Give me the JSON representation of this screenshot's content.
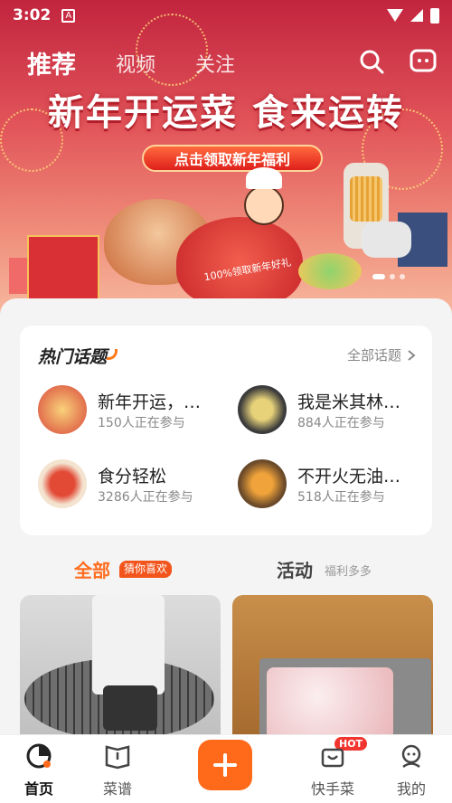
{
  "status_bar": {
    "time": "3:02",
    "notification_icon": "A"
  },
  "top_nav": {
    "tabs": [
      {
        "label": "推荐",
        "active": true
      },
      {
        "label": "视频",
        "active": false
      },
      {
        "label": "关注",
        "active": false
      }
    ],
    "search_icon": "search-icon",
    "message_icon": "message-icon"
  },
  "banner": {
    "headline": "新年开运菜 食来运转",
    "promo_button": "点击领取新年福利",
    "sack_text": "100%领取新年好礼",
    "page_dots": 3,
    "active_dot": 0
  },
  "topics": {
    "title": "热门话题",
    "all_link": "全部话题",
    "items": [
      {
        "name": "新年开运，…",
        "count": "150人正在参与"
      },
      {
        "name": "我是米其林…",
        "count": "884人正在参与"
      },
      {
        "name": "食分轻松",
        "count": "3286人正在参与"
      },
      {
        "name": "不开火无油…",
        "count": "518人正在参与"
      }
    ]
  },
  "feed_tabs": {
    "all": "全部",
    "all_badge": "猜你喜欢",
    "activity": "活动",
    "activity_sub": "福利多多"
  },
  "bottom_nav": {
    "items": [
      {
        "label": "首页",
        "icon": "home-icon",
        "active": true
      },
      {
        "label": "菜谱",
        "icon": "recipe-book-icon",
        "active": false
      },
      {
        "label": "快手菜",
        "icon": "quick-dish-icon",
        "active": false
      },
      {
        "label": "我的",
        "icon": "profile-icon",
        "active": false
      }
    ],
    "hot_badge": "HOT",
    "add_icon": "plus-icon"
  },
  "colors": {
    "accent": "#ff6a1a",
    "badge": "#f2541c",
    "hot": "#f2362f"
  }
}
